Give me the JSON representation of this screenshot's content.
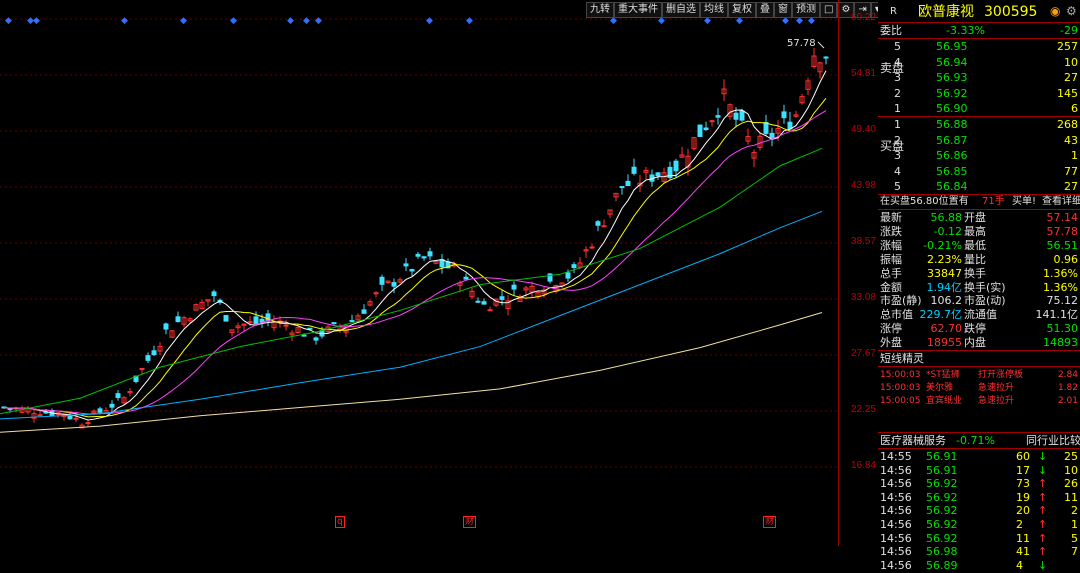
{
  "toolbar": [
    "九转",
    "重大事件",
    "删自选",
    "均线",
    "复权",
    "叠",
    "窗",
    "预测"
  ],
  "price_axis": [
    "60.22",
    "54.81",
    "49.40",
    "43.98",
    "38.57",
    "33.08",
    "27.67",
    "22.25",
    "16.84"
  ],
  "high_label": "57.78",
  "bottom_tags": [
    "q",
    "财",
    "财"
  ],
  "stock": {
    "r_label": "R",
    "name": "欧普康视",
    "code": "300595"
  },
  "weibi": {
    "label": "委比",
    "pct": "-3.33%",
    "val": "-29"
  },
  "sell_group_label": "卖盘",
  "buy_group_label": "买盘",
  "sell_orders": [
    {
      "lvl": "5",
      "price": "56.95",
      "vol": "257"
    },
    {
      "lvl": "4",
      "price": "56.94",
      "vol": "10"
    },
    {
      "lvl": "3",
      "price": "56.93",
      "vol": "27"
    },
    {
      "lvl": "2",
      "price": "56.92",
      "vol": "145"
    },
    {
      "lvl": "1",
      "price": "56.90",
      "vol": "6"
    }
  ],
  "buy_orders": [
    {
      "lvl": "1",
      "price": "56.88",
      "vol": "268"
    },
    {
      "lvl": "2",
      "price": "56.87",
      "vol": "43"
    },
    {
      "lvl": "3",
      "price": "56.86",
      "vol": "1"
    },
    {
      "lvl": "4",
      "price": "56.85",
      "vol": "77"
    },
    {
      "lvl": "5",
      "price": "56.84",
      "vol": "27"
    }
  ],
  "notice": {
    "text": "在买盘56.80位置有",
    "vol": "71手",
    "action": "买单!",
    "link": "查看详细"
  },
  "stats": [
    {
      "l1": "最新",
      "v1": "56.88",
      "c1": "green",
      "l2": "开盘",
      "v2": "57.14",
      "c2": "red"
    },
    {
      "l1": "涨跌",
      "v1": "-0.12",
      "c1": "green",
      "l2": "最高",
      "v2": "57.78",
      "c2": "red"
    },
    {
      "l1": "涨幅",
      "v1": "-0.21%",
      "c1": "green",
      "l2": "最低",
      "v2": "56.51",
      "c2": "green"
    },
    {
      "l1": "振幅",
      "v1": "2.23%",
      "c1": "yellow",
      "l2": "量比",
      "v2": "0.96",
      "c2": "yellow"
    },
    {
      "l1": "总手",
      "v1": "33847",
      "c1": "yellow",
      "l2": "换手",
      "v2": "1.36%",
      "c2": "yellow"
    },
    {
      "l1": "金额",
      "v1": "1.94亿",
      "c1": "cyan",
      "l2": "换手(实)",
      "v2": "1.36%",
      "c2": "yellow"
    },
    {
      "l1": "市盈(静)",
      "v1": "106.2",
      "c1": "white",
      "l2": "市盈(动)",
      "v2": "75.12",
      "c2": "white"
    },
    {
      "l1": "总市值",
      "v1": "229.7亿",
      "c1": "cyan",
      "l2": "流通值",
      "v2": "141.1亿",
      "c2": "white"
    },
    {
      "l1": "涨停",
      "v1": "62.70",
      "c1": "red",
      "l2": "跌停",
      "v2": "51.30",
      "c2": "green"
    },
    {
      "l1": "外盘",
      "v1": "18955",
      "c1": "red",
      "l2": "内盘",
      "v2": "14893",
      "c2": "green"
    }
  ],
  "short_title": "短线精灵",
  "short_items": [
    {
      "time": "15:00:03",
      "name": "*ST猛狮",
      "event": "打开涨停板",
      "val": "2.84"
    },
    {
      "time": "15:00:03",
      "name": "美尔雅",
      "event": "急速拉升",
      "val": "1.82"
    },
    {
      "time": "15:00:05",
      "name": "宜宾纸业",
      "event": "急速拉升",
      "val": "2.01"
    }
  ],
  "sector": {
    "name": "医疗器械服务",
    "pct": "-0.71%",
    "compare": "同行业比较"
  },
  "ticks": [
    {
      "time": "14:55",
      "price": "56.91",
      "vol": "60",
      "dir": "down",
      "n": "25"
    },
    {
      "time": "14:56",
      "price": "56.91",
      "vol": "17",
      "dir": "down",
      "n": "10"
    },
    {
      "time": "14:56",
      "price": "56.92",
      "vol": "73",
      "dir": "up",
      "n": "26"
    },
    {
      "time": "14:56",
      "price": "56.92",
      "vol": "19",
      "dir": "up",
      "n": "11"
    },
    {
      "time": "14:56",
      "price": "56.92",
      "vol": "20",
      "dir": "up",
      "n": "2"
    },
    {
      "time": "14:56",
      "price": "56.92",
      "vol": "2",
      "dir": "up",
      "n": "1"
    },
    {
      "time": "14:56",
      "price": "56.92",
      "vol": "11",
      "dir": "up",
      "n": "5"
    },
    {
      "time": "14:56",
      "price": "56.98",
      "vol": "41",
      "dir": "up",
      "n": "7"
    },
    {
      "time": "14:56",
      "price": "56.89",
      "vol": "4",
      "dir": "down",
      "n": ""
    }
  ]
}
